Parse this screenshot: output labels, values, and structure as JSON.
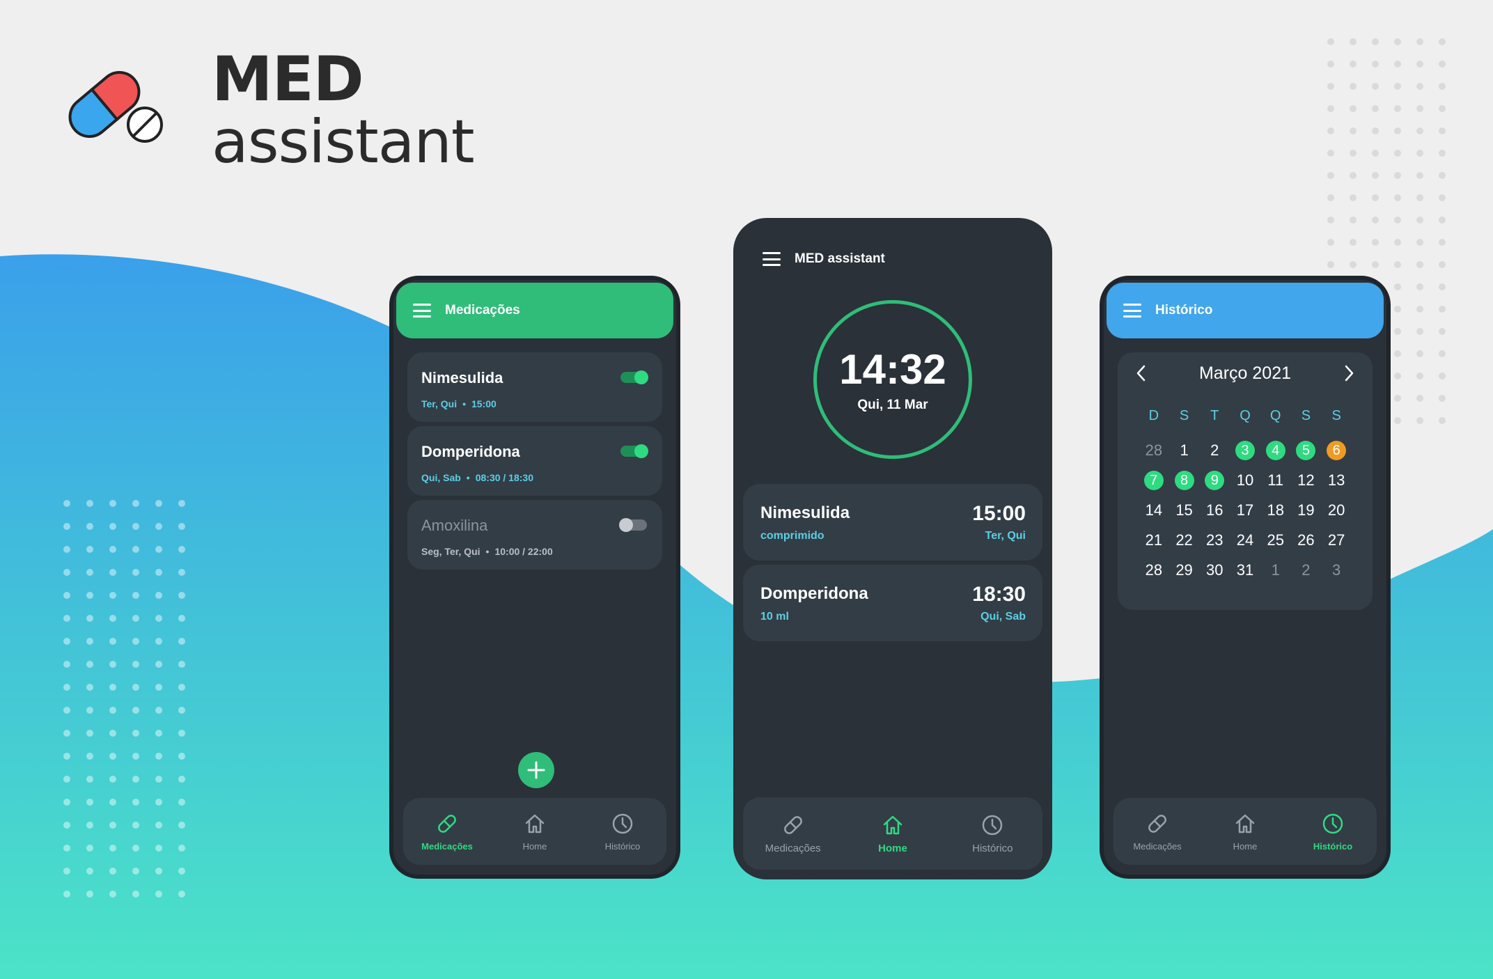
{
  "brand": {
    "line1": "MED",
    "line2": "assistant",
    "colors": {
      "pill_red": "#f15454",
      "pill_blue": "#3aa6ee",
      "text": "#2b2b2b"
    }
  },
  "theme": {
    "background": "#efefef",
    "wave_gradient": [
      "#3aa0ea",
      "#4be3c7"
    ],
    "phone_bg": "#2a3138",
    "card_bg": "#333d46",
    "accent_green": "#2fbd79",
    "accent_blue": "#41a6ec",
    "accent_cyan": "#5ccfe6",
    "accent_orange": "#ef9b23"
  },
  "medications_screen": {
    "title": "Medicações",
    "menu_icon": "hamburger-icon",
    "items": [
      {
        "name": "Nimesulida",
        "days": "Ter, Qui",
        "times": "15:00",
        "enabled": true
      },
      {
        "name": "Domperidona",
        "days": "Qui, Sab",
        "times": "08:30 / 18:30",
        "enabled": true
      },
      {
        "name": "Amoxilina",
        "days": "Seg, Ter, Qui",
        "times": "10:00 / 22:00",
        "enabled": false
      }
    ],
    "add_icon": "plus-icon"
  },
  "home_screen": {
    "title": "MED assistant",
    "menu_icon": "hamburger-icon",
    "clock": {
      "time": "14:32",
      "date": "Qui, 11 Mar"
    },
    "doses": [
      {
        "name": "Nimesulida",
        "form": "comprimido",
        "time": "15:00",
        "days": "Ter, Qui"
      },
      {
        "name": "Domperidona",
        "form": "10 ml",
        "time": "18:30",
        "days": "Qui, Sab"
      }
    ]
  },
  "history_screen": {
    "title": "Histórico",
    "menu_icon": "hamburger-icon",
    "month": "Março 2021",
    "prev_icon": "chevron-left-icon",
    "next_icon": "chevron-right-icon",
    "weekdays": [
      "D",
      "S",
      "T",
      "Q",
      "Q",
      "S",
      "S"
    ],
    "weeks": [
      [
        {
          "d": "28",
          "m": true
        },
        {
          "d": "1"
        },
        {
          "d": "2"
        },
        {
          "d": "3",
          "s": "taken"
        },
        {
          "d": "4",
          "s": "taken"
        },
        {
          "d": "5",
          "s": "taken"
        },
        {
          "d": "6",
          "s": "partial"
        }
      ],
      [
        {
          "d": "7",
          "s": "taken"
        },
        {
          "d": "8",
          "s": "taken"
        },
        {
          "d": "9",
          "s": "taken"
        },
        {
          "d": "10"
        },
        {
          "d": "11"
        },
        {
          "d": "12"
        },
        {
          "d": "13"
        }
      ],
      [
        {
          "d": "14"
        },
        {
          "d": "15"
        },
        {
          "d": "16"
        },
        {
          "d": "17"
        },
        {
          "d": "18"
        },
        {
          "d": "19"
        },
        {
          "d": "20"
        }
      ],
      [
        {
          "d": "21"
        },
        {
          "d": "22"
        },
        {
          "d": "23"
        },
        {
          "d": "24"
        },
        {
          "d": "25"
        },
        {
          "d": "26"
        },
        {
          "d": "27"
        }
      ],
      [
        {
          "d": "28"
        },
        {
          "d": "29"
        },
        {
          "d": "30"
        },
        {
          "d": "31"
        },
        {
          "d": "1",
          "m": true
        },
        {
          "d": "2",
          "m": true
        },
        {
          "d": "3",
          "m": true
        }
      ]
    ]
  },
  "bottom_nav": {
    "items": [
      {
        "label": "Medicações",
        "icon": "pill-icon"
      },
      {
        "label": "Home",
        "icon": "home-icon"
      },
      {
        "label": "Histórico",
        "icon": "clock-icon"
      }
    ],
    "active": {
      "medications_screen": 0,
      "home_screen": 1,
      "history_screen": 2
    }
  }
}
